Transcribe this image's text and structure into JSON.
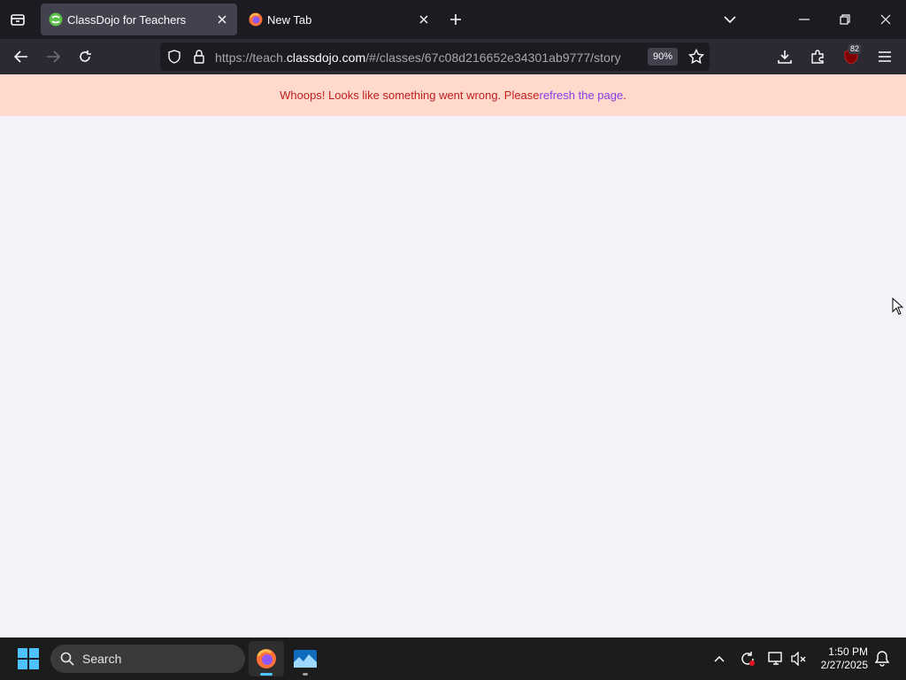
{
  "browser": {
    "tabs": [
      {
        "title": "ClassDojo for Teachers",
        "active": true,
        "favicon": "classdojo-icon"
      },
      {
        "title": "New Tab",
        "active": false,
        "favicon": "firefox-icon"
      }
    ],
    "url_prefix": "https://teach.",
    "url_host": "classdojo.com",
    "url_path": "/#/classes/67c08d216652e34301ab9777/story",
    "zoom": "90%",
    "extension_badge": "82"
  },
  "banner": {
    "message": "Whoops! Looks like something went wrong. Please ",
    "link_text": "refresh the page",
    "suffix": ".",
    "bg_color": "#ffd9cc",
    "text_color": "#c11e1e",
    "link_color": "#8b3ce6"
  },
  "taskbar": {
    "search_placeholder": "Search",
    "time": "1:50 PM",
    "date": "2/27/2025"
  }
}
